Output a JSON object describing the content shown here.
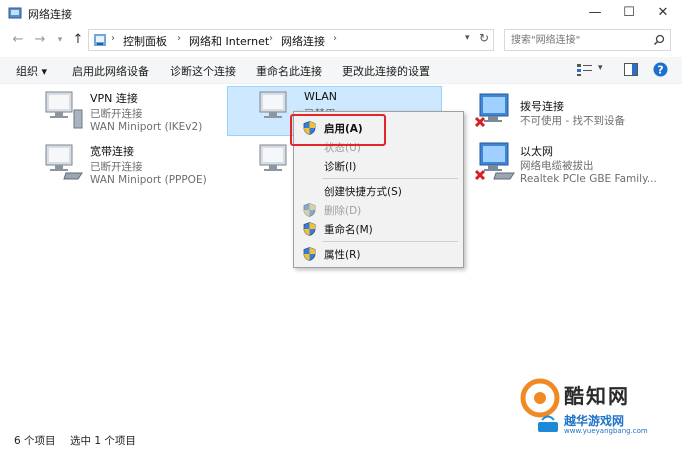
{
  "window": {
    "title": "网络连接",
    "controls": [
      "—",
      "☐",
      "✕"
    ]
  },
  "address": {
    "breadcrumbs": [
      "控制面板",
      "网络和 Internet",
      "网络连接"
    ],
    "search_placeholder": "搜索\"网络连接\""
  },
  "commands": [
    "组织 ▾",
    "启用此网络设备",
    "诊断这个连接",
    "重命名此连接",
    "更改此连接的设置"
  ],
  "connections": [
    {
      "name": "VPN 连接",
      "status": "已断开连接",
      "device": "WAN Miniport (IKEv2)"
    },
    {
      "name": "宽带连接",
      "status": "已断开连接",
      "device": "WAN Miniport (PPPOE)"
    },
    {
      "name": "WLAN",
      "status": "已禁用",
      "device": ""
    },
    {
      "name": "拨号连接",
      "status": "不可使用 - 找不到设备",
      "device": ""
    },
    {
      "name": "以太网",
      "status": "网络电缆被拔出",
      "device": "Realtek PCIe GBE Family..."
    }
  ],
  "context_menu": {
    "items": [
      "启用(A)",
      "状态(U)",
      "诊断(I)",
      "创建快捷方式(S)",
      "删除(D)",
      "重命名(M)",
      "属性(R)"
    ]
  },
  "status_bar": {
    "count": "6 个项目",
    "selection": "选中 1 个项目"
  },
  "watermark": {
    "brand": "酷知网",
    "site_name": "越华游戏网",
    "site_url": "www.yueyangbang.com"
  },
  "colors": {
    "selection_bg": "#cde8ff",
    "highlight_red": "#e0262b",
    "help_blue": "#1e6fd0"
  }
}
